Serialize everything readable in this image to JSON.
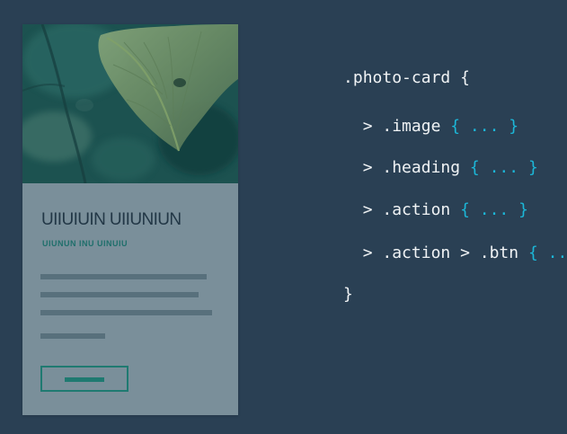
{
  "card": {
    "heading": "UIIUIUIN UIIUNIUN",
    "subheading": "UIUNUN INU UINUIU"
  },
  "code": {
    "line1": ".photo-card {",
    "line2_prefix": "  > .image ",
    "line2_braces": "{ ... }",
    "line3_prefix": "  > .heading ",
    "line3_braces": "{ ... }",
    "line4_prefix": "  > .action ",
    "line4_braces": "{ ... }",
    "line5_prefix": "  > .action > .btn ",
    "line5_braces": "{ ... }",
    "line6": "}"
  },
  "colors": {
    "background": "#2a4054",
    "card_body": "#7a8f9a",
    "card_text": "#223746",
    "accent": "#1f7a71",
    "code_text": "#f0f3f5",
    "braces": "#1cb7d8"
  }
}
